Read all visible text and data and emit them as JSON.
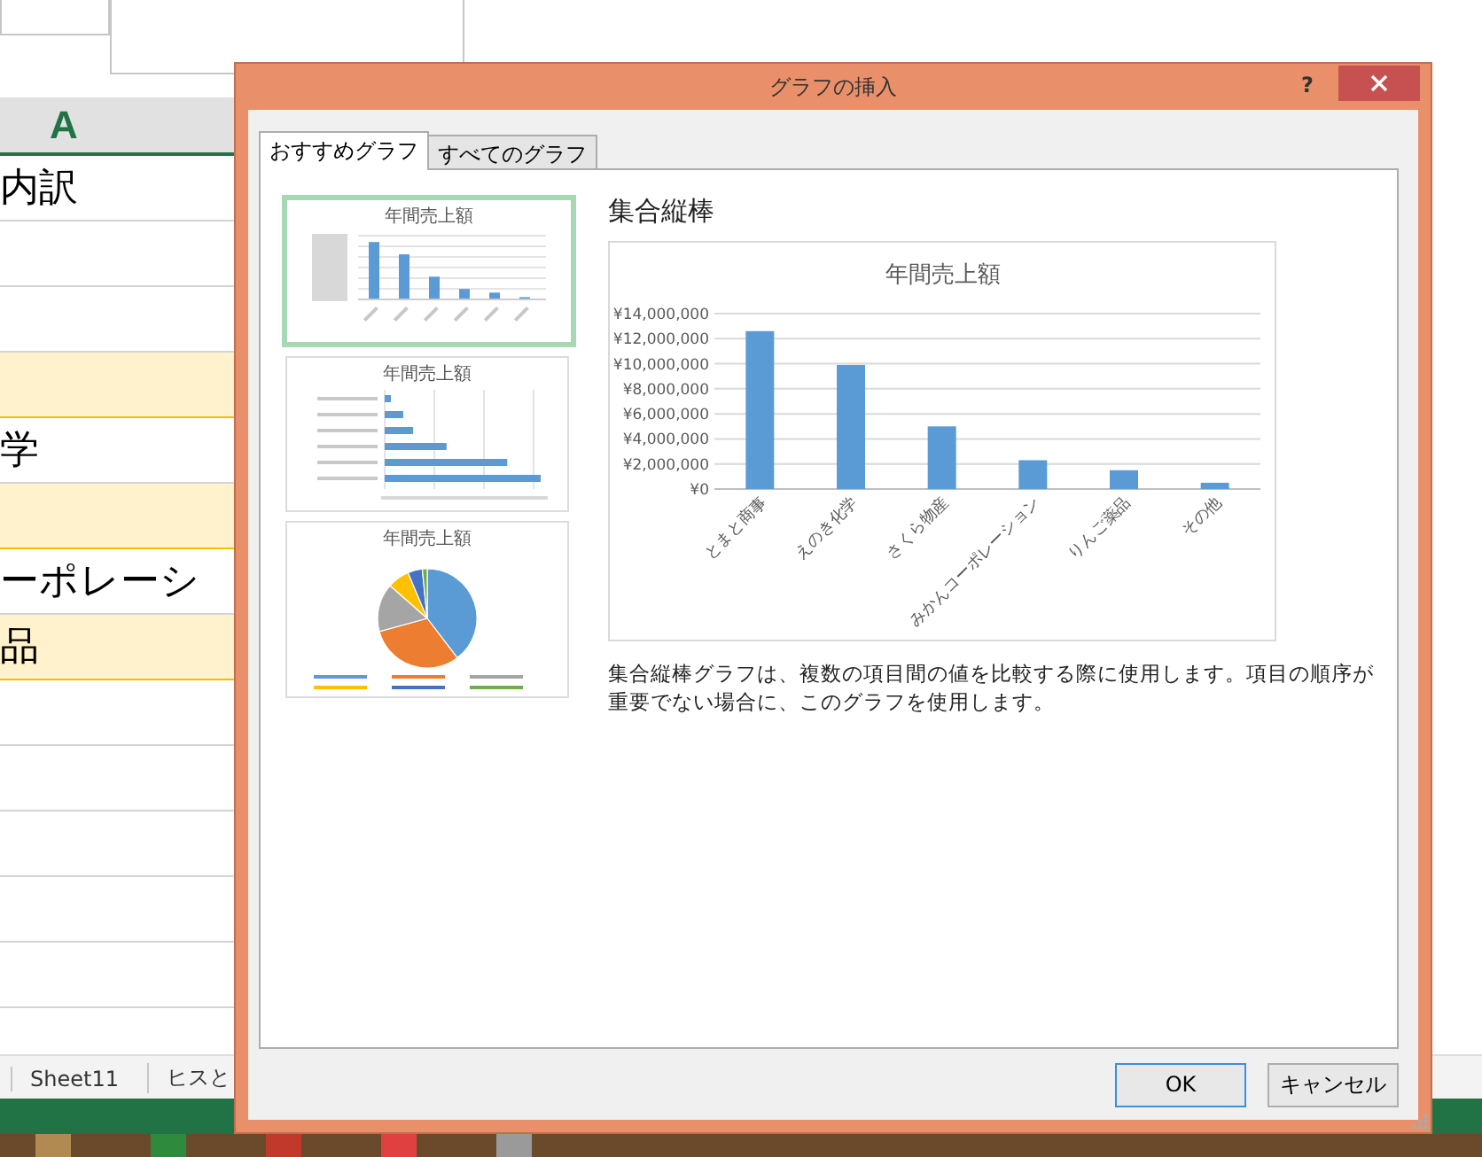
{
  "spreadsheet": {
    "column_header": "A",
    "rows": [
      {
        "text": "内訳",
        "highlighted": false
      },
      {
        "highlighted": false
      },
      {
        "highlighted": false
      },
      {
        "highlighted": true
      },
      {
        "text": "学",
        "highlighted": false
      },
      {
        "highlighted": true
      },
      {
        "text": "ーポレーシ",
        "highlighted": false
      },
      {
        "text": "品",
        "highlighted": true
      },
      {
        "highlighted": false
      },
      {
        "highlighted": false
      },
      {
        "highlighted": false
      },
      {
        "highlighted": false
      },
      {
        "highlighted": false
      }
    ],
    "sheet_tabs": [
      "Sheet11",
      "ヒスと"
    ]
  },
  "dialog": {
    "title": "グラフの挿入",
    "help": "?",
    "tabs": [
      {
        "label": "おすすめグラフ",
        "selected": true
      },
      {
        "label": "すべてのグラフ",
        "selected": false
      }
    ],
    "thumbnails": [
      {
        "kind": "column",
        "title": "年間売上額",
        "selected": true
      },
      {
        "kind": "bar",
        "title": "年間売上額",
        "selected": false
      },
      {
        "kind": "pie",
        "title": "年間売上額",
        "selected": false
      }
    ],
    "preview_heading": "集合縦棒",
    "chart_data": {
      "type": "bar",
      "title": "年間売上額",
      "categories": [
        "とまと商事",
        "えのき化学",
        "さくら物産",
        "みかんコーポレーション",
        "りんご薬品",
        "その他"
      ],
      "values": [
        12600000,
        9900000,
        5000000,
        2300000,
        1500000,
        500000
      ],
      "grid": true,
      "ylim": [
        0,
        14000000
      ],
      "yticks": [
        {
          "value": 0,
          "label": "¥0"
        },
        {
          "value": 2000000,
          "label": "¥2,000,000"
        },
        {
          "value": 4000000,
          "label": "¥4,000,000"
        },
        {
          "value": 6000000,
          "label": "¥6,000,000"
        },
        {
          "value": 8000000,
          "label": "¥8,000,000"
        },
        {
          "value": 10000000,
          "label": "¥10,000,000"
        },
        {
          "value": 12000000,
          "label": "¥12,000,000"
        },
        {
          "value": 14000000,
          "label": "¥14,000,000"
        }
      ]
    },
    "description": "集合縦棒グラフは、複数の項目間の値を比較する際に使用します。項目の順序が重要でない場合に、このグラフを使用します。",
    "buttons": [
      "OK",
      "キャンセル"
    ]
  }
}
